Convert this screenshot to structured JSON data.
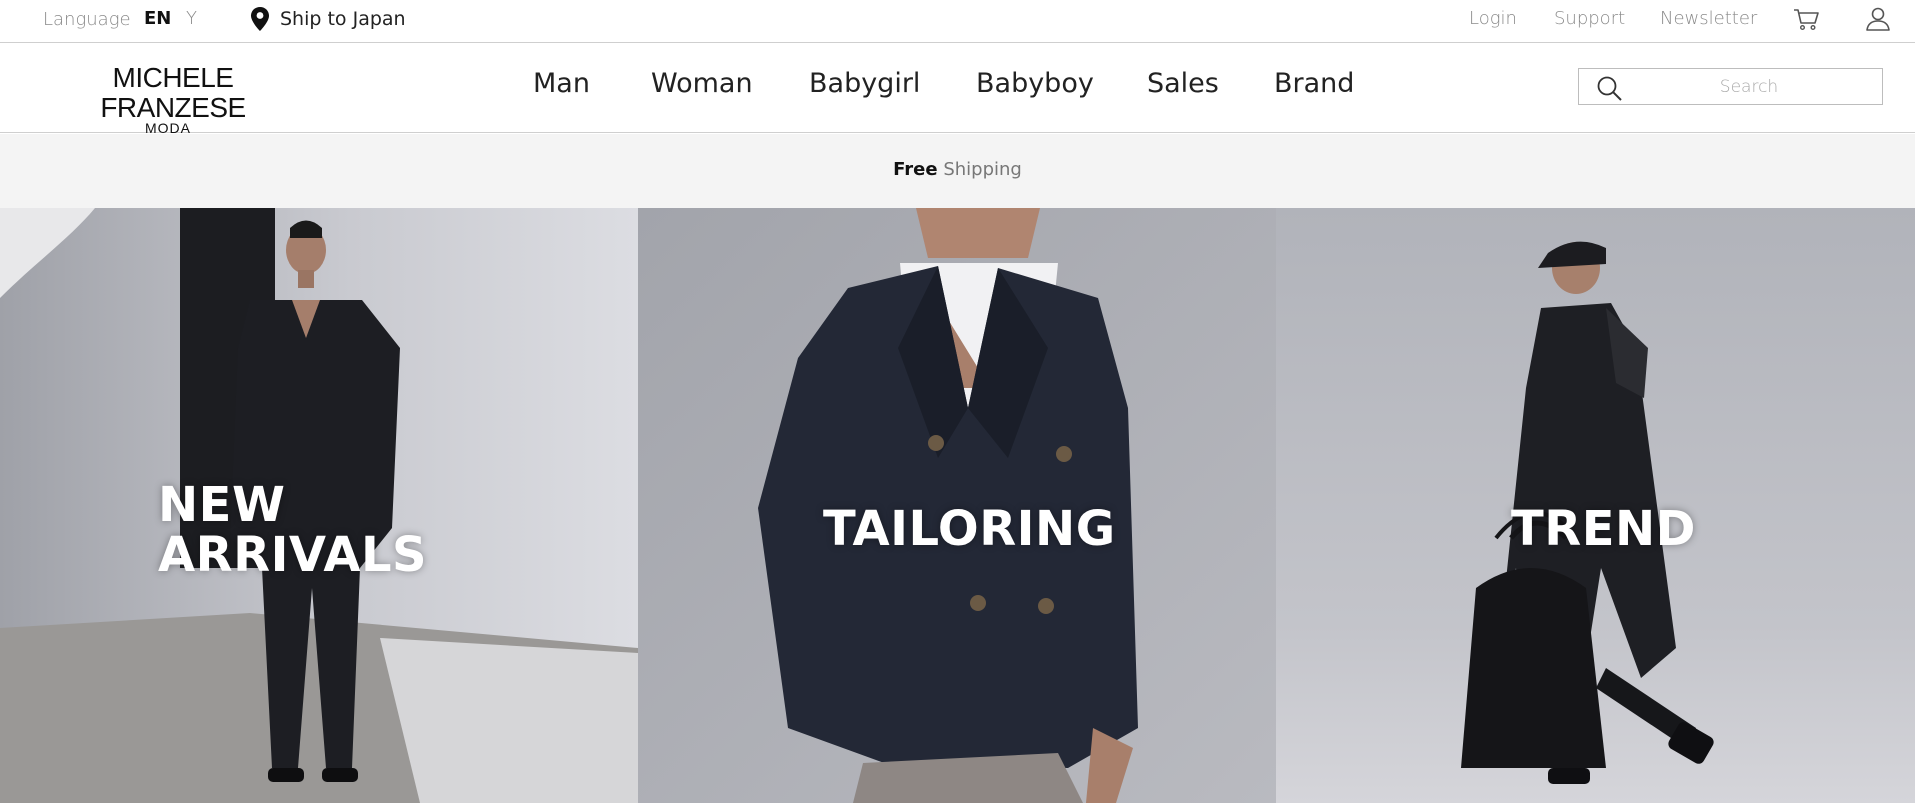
{
  "topbar": {
    "language_label": "Language",
    "language_current": "EN",
    "language_dropdown_glyph": "Y",
    "ship_to": "Ship to Japan",
    "ship_icon": "location-pin-icon",
    "links": [
      "Login",
      "Support",
      "Newsletter"
    ],
    "cart_icon": "cart-icon",
    "account_icon": "user-icon"
  },
  "header": {
    "brand_name": "MICHELE FRANZESE",
    "brand_sub": "MODA",
    "nav": [
      "Man",
      "Woman",
      "Babygirl",
      "Babyboy",
      "Sales",
      "Brand"
    ],
    "search": {
      "placeholder": "Search",
      "icon": "search-icon"
    }
  },
  "promo": {
    "bold": "Free",
    "rest": "Shipping"
  },
  "hero": {
    "panels": [
      {
        "title_line1": "NEW",
        "title_line2": "ARRIVALS"
      },
      {
        "title": "TAILORING"
      },
      {
        "title": "TREND"
      }
    ]
  },
  "colors": {
    "border": "#cfcfcf",
    "promo_bg": "#f4f4f4",
    "muted_text": "#8a8a8a",
    "hero_text": "#ffffff"
  }
}
